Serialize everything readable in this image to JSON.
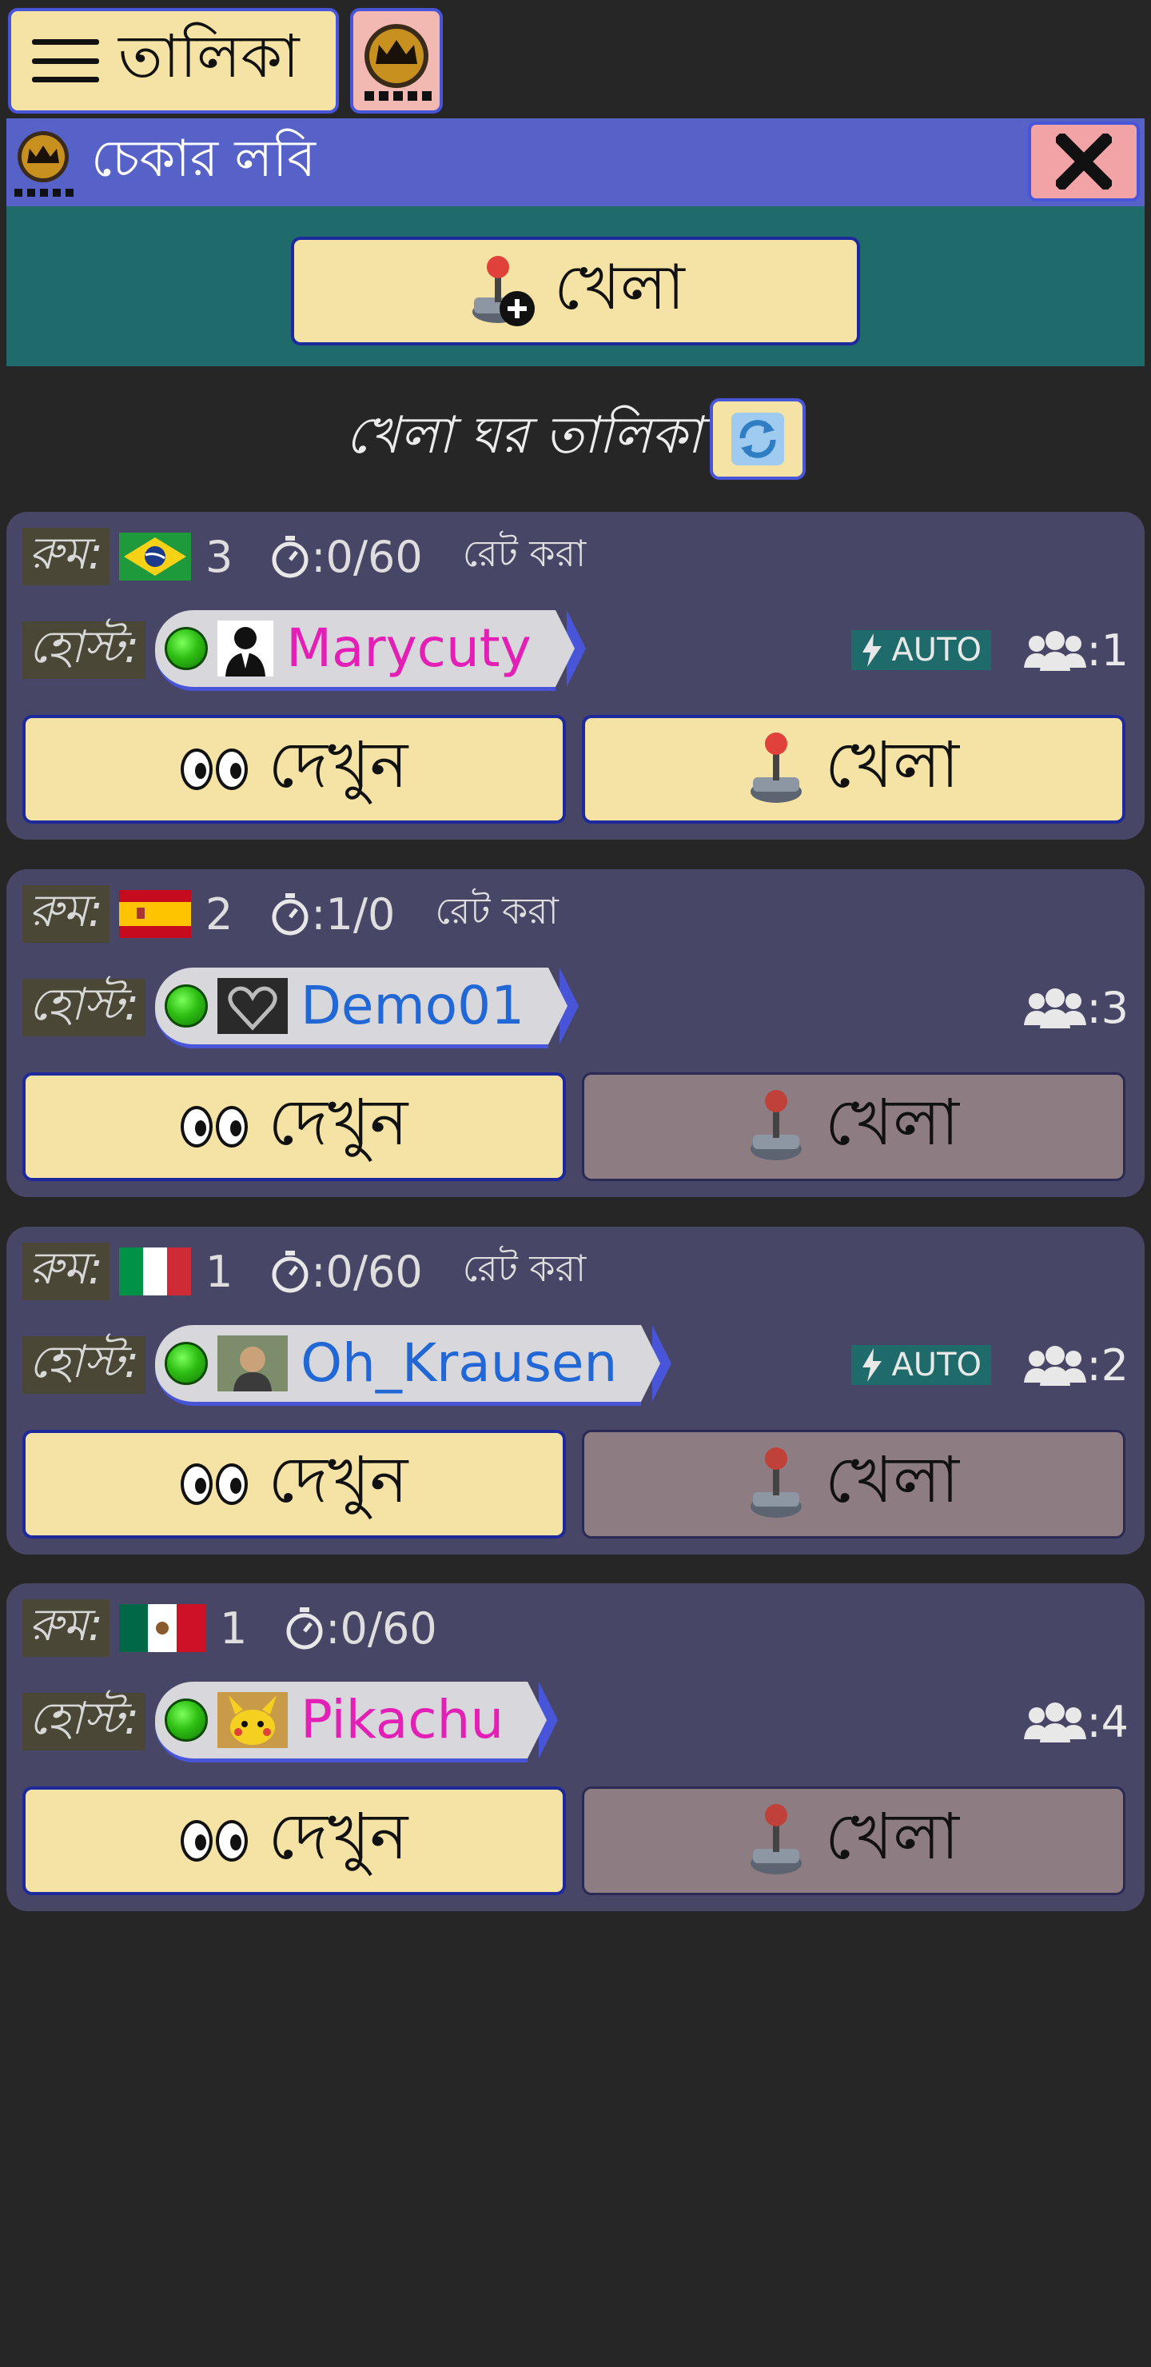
{
  "topbar": {
    "menu_label": "তালিকা"
  },
  "lobby": {
    "title": "চেকার লবি",
    "create_label": "খেলা"
  },
  "room_list": {
    "title": "খেলা ঘর তালিকা"
  },
  "rooms": [
    {
      "room_label": "রুম:",
      "flag": "brazil-flag-icon",
      "number": "3",
      "time": ":0/60",
      "rated": "রেট করা",
      "host_label": "হোস্ট:",
      "host_name": "Marycuty",
      "name_color": "#e31fb5",
      "auto": "AUTO",
      "players": ":1",
      "watch_label": "দেখুন",
      "play_label": "খেলা",
      "play_enabled": true
    },
    {
      "room_label": "রুম:",
      "flag": "spain-flag-icon",
      "number": "2",
      "time": ":1/0",
      "rated": "রেট করা",
      "host_label": "হোস্ট:",
      "host_name": "Demo01",
      "name_color": "#2267d6",
      "auto": "",
      "players": ":3",
      "watch_label": "দেখুন",
      "play_label": "খেলা",
      "play_enabled": false
    },
    {
      "room_label": "রুম:",
      "flag": "italy-flag-icon",
      "number": "1",
      "time": ":0/60",
      "rated": "রেট করা",
      "host_label": "হোস্ট:",
      "host_name": "Oh_Krausen",
      "name_color": "#2267d6",
      "auto": "AUTO",
      "players": ":2",
      "watch_label": "দেখুন",
      "play_label": "খেলা",
      "play_enabled": false
    },
    {
      "room_label": "রুম:",
      "flag": "mexico-flag-icon",
      "number": "1",
      "time": ":0/60",
      "rated": "",
      "host_label": "হোস্ট:",
      "host_name": "Pikachu",
      "name_color": "#e31fb5",
      "auto": "",
      "players": ":4",
      "watch_label": "দেখুন",
      "play_label": "খেলা",
      "play_enabled": false
    }
  ]
}
